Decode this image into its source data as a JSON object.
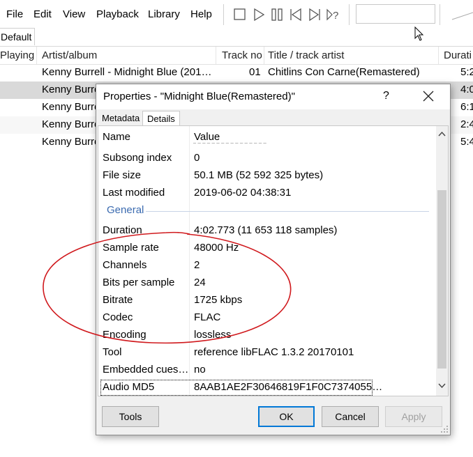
{
  "menu": {
    "items": [
      "File",
      "Edit",
      "View",
      "Playback",
      "Library",
      "Help"
    ]
  },
  "toolbar": {
    "buttons": [
      "stop-icon",
      "play-icon",
      "pause-icon",
      "previous-icon",
      "next-icon",
      "random-icon"
    ]
  },
  "playlist_tabs": {
    "active": "Default"
  },
  "playlist": {
    "columns": [
      "Playing",
      "Artist/album",
      "Track no",
      "Title / track artist",
      "Durati"
    ],
    "rows": [
      {
        "artist": "Kenny Burrell - Midnight Blue (201…",
        "track": "01",
        "title": "Chitlins Con Carne(Remastered)",
        "duration": "5:2"
      },
      {
        "artist": "Kenny Burre",
        "track": "",
        "title": "",
        "duration": "4:0"
      },
      {
        "artist": "Kenny Burre",
        "track": "",
        "title": "",
        "duration": "6:1"
      },
      {
        "artist": "Kenny Burre",
        "track": "",
        "title": "",
        "duration": "2:4"
      },
      {
        "artist": "Kenny Burre",
        "track": "",
        "title": "",
        "duration": "5:4"
      }
    ]
  },
  "dialog": {
    "title": "Properties - \"Midnight Blue(Remastered)\"",
    "help": "?",
    "tabs": [
      "Metadata",
      "Details"
    ],
    "active_tab": "Details",
    "grid_header": {
      "name": "Name",
      "value": "Value"
    },
    "rows_top": [
      {
        "name": "Subsong index",
        "value": "0"
      },
      {
        "name": "File size",
        "value": "50.1 MB (52 592 325 bytes)"
      },
      {
        "name": "Last modified",
        "value": "2019-06-02 04:38:31"
      }
    ],
    "group": "General",
    "rows_general": [
      {
        "name": "Duration",
        "value": "4:02.773 (11 653 118 samples)"
      },
      {
        "name": "Sample rate",
        "value": "48000 Hz"
      },
      {
        "name": "Channels",
        "value": "2"
      },
      {
        "name": "Bits per sample",
        "value": "24"
      },
      {
        "name": "Bitrate",
        "value": "1725 kbps"
      },
      {
        "name": "Codec",
        "value": "FLAC"
      },
      {
        "name": "Encoding",
        "value": "lossless"
      },
      {
        "name": "Tool",
        "value": "reference libFLAC 1.3.2 20170101"
      },
      {
        "name": "Embedded cues…",
        "value": "no"
      },
      {
        "name": "Audio MD5",
        "value": "8AAB1AE2F30646819F1F0C7374055…"
      }
    ],
    "buttons": {
      "tools": "Tools",
      "ok": "OK",
      "cancel": "Cancel",
      "apply": "Apply"
    }
  },
  "colors": {
    "selection": "#d9d9d9",
    "group_label": "#3b6bb0",
    "default_button_border": "#0078d7",
    "annotation_ellipse": "#d0191d"
  }
}
